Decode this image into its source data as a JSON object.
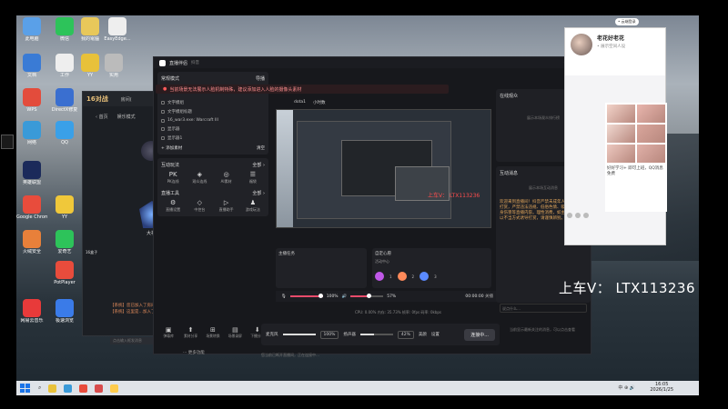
{
  "desktop": {
    "icons": [
      {
        "label": "此电脑",
        "color": "#5aa0e8"
      },
      {
        "label": "微信",
        "color": "#2dc35a"
      },
      {
        "label": "我的電腦",
        "color": "#e8c85a"
      },
      {
        "label": "EasyEdge...",
        "color": "#eeeeee"
      },
      {
        "label": "文档",
        "color": "#3a7bd5"
      },
      {
        "label": "工作",
        "color": "#eeeeee"
      },
      {
        "label": "YY",
        "color": "#e8c13a"
      },
      {
        "label": "实用",
        "color": "#bbbbbb"
      },
      {
        "label": "DirectX修复",
        "color": "#3a6fd0"
      },
      {
        "label": "WPS",
        "color": "#e34c3c"
      },
      {
        "label": "QQ",
        "color": "#3aa0e8"
      },
      {
        "label": "网络",
        "color": "#3a9ad8"
      },
      {
        "label": "Google Chrome",
        "color": "#e84c3c"
      },
      {
        "label": "YY",
        "color": "#f0c83a"
      },
      {
        "label": "英雄联盟",
        "color": "#1b2a5a"
      },
      {
        "label": "爱奇艺",
        "color": "#2dc35a"
      },
      {
        "label": "PotPlayer",
        "color": "#e84c3c"
      },
      {
        "label": "火绒安全",
        "color": "#e8803a"
      },
      {
        "label": "网易云音乐",
        "color": "#e83a3a"
      },
      {
        "label": "极速浏览",
        "color": "#3a7be8"
      }
    ]
  },
  "taskbar": {
    "clock_time": "16:05",
    "clock_date": "2026/1/25",
    "tray": "中 ⊕ 🔊",
    "icons": [
      "#e8c13a",
      "#3a9ad8",
      "#e84c3c",
      "#d84c4c",
      "#ffcc4d"
    ]
  },
  "gamewin": {
    "logo": "16对战",
    "nav": "房间(",
    "back": "‹  首页",
    "mode": "娱乐模式",
    "rank": "大神",
    "msg1": "【系统】您已加入了房间",
    "msg2": "【系统】这里是…加入了房间",
    "input_placeholder": "点击输入框发消息",
    "strip": "16盒子"
  },
  "mainwin": {
    "title": "直播伴侣",
    "subtitle": "抖音",
    "controls": [
      "—",
      "⧉",
      "✕"
    ],
    "mode": "常规模式",
    "guide": "导播",
    "scene": "场景一",
    "res1": "16",
    "res2": "kk",
    "sources": [
      {
        "label": "文字模组"
      },
      {
        "label": "文字模组标题"
      },
      {
        "label": "16_war3.exe: Warcraft III"
      },
      {
        "label": "显示器"
      },
      {
        "label": "显示器1"
      }
    ],
    "add_source": "+ 添加素材",
    "add_hint": "清空",
    "interact_title": "互动玩法",
    "interact_all": "全部 ›",
    "interact_tools": [
      {
        "icon": "PK",
        "label": "PK连线"
      },
      {
        "icon": "◈",
        "label": "观众连线"
      },
      {
        "icon": "◎",
        "label": "AI素材"
      },
      {
        "icon": "☰",
        "label": "福袋"
      }
    ],
    "live_title": "直播工具",
    "live_all": "全部 ›",
    "live_tools": [
      {
        "icon": "⚙",
        "label": "直播设置"
      },
      {
        "icon": "◇",
        "label": "中控台"
      },
      {
        "icon": "▷",
        "label": "直播助手"
      },
      {
        "icon": "♟",
        "label": "游戏玩法"
      }
    ],
    "bottom_tools": [
      {
        "icon": "▣",
        "label": "弹幕库"
      },
      {
        "icon": "⬆",
        "label": "素材分享"
      },
      {
        "icon": "⊞",
        "label": "场景转换"
      },
      {
        "icon": "▤",
        "label": "场景录屏"
      },
      {
        "icon": "⬇",
        "label": "下播分析"
      }
    ],
    "more": "··· 更多功能",
    "banner": "当前场景无法展示人脸机制特殊，建议添加进入人脸的摄像头素材",
    "scene_tabs": [
      "dota1",
      "小时数"
    ],
    "preview_wm": "上车V： LTX113236",
    "dash_left": "主播任务",
    "dash_right_title": "自定心愿",
    "dash_right_sub": "活动中心",
    "gift_counts": [
      "1",
      "2",
      "3"
    ],
    "mic_pct": "100%",
    "speaker_pct": "57%",
    "timecode": "00:00:00",
    "timecode_label": "关播",
    "stats": "CPU: 0.00%   内存: 35.73%   帧率: 0fps   码率: 0kbps",
    "mixer_mic": "麦克风",
    "mixer_pct1": "100%",
    "mixer_spk": "扬声器",
    "mixer_pct2": "42%",
    "mixer_beauty": "美颜",
    "mixer_set": "设置",
    "connect": "连接中...",
    "foot": "您当前已断开直播间，正在连接中…",
    "online_title": "在线观众",
    "online_empty": "展示本场观众排行榜",
    "chat_title": "互动消息",
    "chat_empty": "展示本场互动消息",
    "chat_msg": "欢迎来到直播间！抖音严禁未成年人直播或私人打赏，严禁违法违规、低俗色情、吸烟酗酒、人身伤害等直播内容。理性消费，如主播在直播中以不当方式诱导打赏，请谨慎辨别。",
    "chat_input": "说点什么…",
    "chat_tip": "当前显示最新关注的消息，可以点击查看"
  },
  "watermark": "上车V： LTX113236",
  "qq": {
    "pill": "• 云端登录",
    "name": "老花好老花",
    "sub": "• 展示空间人设",
    "text": "好好学习+ 即可上班，QQ消息免费",
    "pic_colors": [
      "#f2d3c9",
      "#e8b5ad",
      "#f0d8d0",
      "#d9a69c",
      "#ecc8bf",
      "#e0b0a8"
    ]
  }
}
